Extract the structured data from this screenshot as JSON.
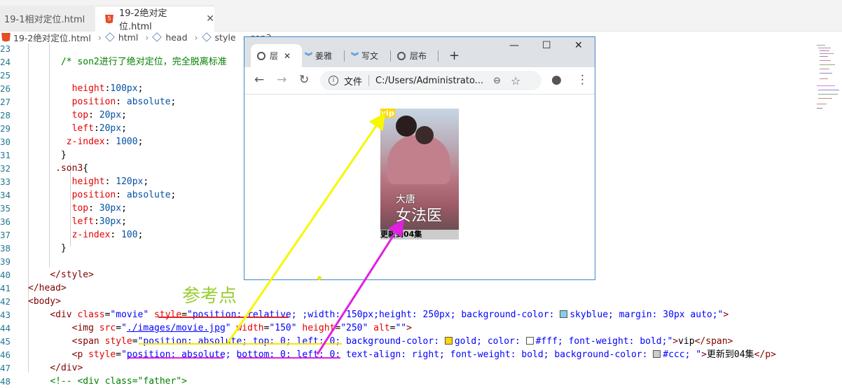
{
  "editor_tabs": [
    {
      "label": "19-1相对定位.html",
      "active": false
    },
    {
      "label": "19-2绝对定位.html",
      "active": true
    }
  ],
  "breadcrumb": [
    "19-2绝对定位.html",
    "html",
    "head",
    "style",
    "son3"
  ],
  "code_lines": [
    {
      "n": "23",
      "html": ""
    },
    {
      "n": "24",
      "html": "      <span class='c-cm'>/* son2进行了绝对定位，完全脱离标准</span>"
    },
    {
      "n": "25",
      "html": ""
    },
    {
      "n": "26",
      "html": "        <span class='c-pr'>height</span>:<span class='c-vl'>100px</span>;"
    },
    {
      "n": "27",
      "html": "        <span class='c-pr'>position</span>: <span class='c-vl'>absolute</span>;"
    },
    {
      "n": "28",
      "html": "        <span class='c-pr'>top</span>: <span class='c-vl'>20px</span>;"
    },
    {
      "n": "29",
      "html": "        <span class='c-pr'>left</span>:<span class='c-vl'>20px</span>;"
    },
    {
      "n": "30",
      "html": "       <span class='c-pr'>z-index</span>: <span class='c-vl'>1000</span>;"
    },
    {
      "n": "31",
      "html": "      }"
    },
    {
      "n": "32",
      "html": "     <span class='c-tg'>.son3</span>{"
    },
    {
      "n": "33",
      "html": "        <span class='c-pr'>height</span>: <span class='c-vl'>120px</span>;"
    },
    {
      "n": "34",
      "html": "        <span class='c-pr'>position</span>: <span class='c-vl'>absolute</span>;"
    },
    {
      "n": "35",
      "html": "        <span class='c-pr'>top</span>: <span class='c-vl'>30px</span>;"
    },
    {
      "n": "36",
      "html": "        <span class='c-pr'>left</span>:<span class='c-vl'>30px</span>;"
    },
    {
      "n": "37",
      "html": "        <span class='c-pr'>z-index</span>: <span class='c-vl'>100</span>;"
    },
    {
      "n": "38",
      "html": "      }"
    },
    {
      "n": "39",
      "html": ""
    },
    {
      "n": "40",
      "html": "    <span class='c-tg'>&lt;/style&gt;</span>"
    },
    {
      "n": "41",
      "html": "<span class='c-tg'>&lt;/head&gt;</span>"
    },
    {
      "n": "42",
      "html": "<span class='c-tg'>&lt;body&gt;</span>"
    },
    {
      "n": "43",
      "html": "    <span class='c-tg'>&lt;div</span> <span class='c-at'>class</span>=<span class='c-st'>\"movie\"</span> <span class='c-at'>style</span>=<span class='c-st'>\"position: relative; ;width: 150px;height: 250px; background-color: <i class='swatch' style='background:#87ceeb'></i>skyblue; margin: 30px auto;\"</span><span class='c-tg'>&gt;</span>"
    },
    {
      "n": "44",
      "html": "        <span class='c-tg'>&lt;img</span> <span class='c-at'>src</span>=<span class='c-st'>\"<u>./images/movie.jpg</u>\"</span> <span class='c-at'>width</span>=<span class='c-st'>\"150\"</span> <span class='c-at'>height</span>=<span class='c-st'>\"250\"</span> <span class='c-at'>alt</span>=<span class='c-st'>\"\"</span><span class='c-tg'>&gt;</span>"
    },
    {
      "n": "45",
      "html": "        <span class='c-tg'>&lt;span</span> <span class='c-at'>style</span>=<span class='c-st'>\"position: absolute; top: 0; left: 0; background-color: <i class='swatch' style='background:gold'></i>gold; color: <i class='swatch' style='background:#fff'></i>#fff; font-weight: bold;\"</span><span class='c-tg'>&gt;</span>vip<span class='c-tg'>&lt;/span&gt;</span>"
    },
    {
      "n": "46",
      "html": "        <span class='c-tg'>&lt;p</span> <span class='c-at'>style</span>=<span class='c-st'>\"position: absolute; bottom: 0; left: 0; text-align: right; font-weight: bold; background-color: <i class='swatch' style='background:#ccc'></i>#ccc; \"</span><span class='c-tg'>&gt;</span>更新到04集<span class='c-tg'>&lt;/p&gt;</span>"
    },
    {
      "n": "47",
      "html": "    <span class='c-tg'>&lt;/div&gt;</span>"
    },
    {
      "n": "48",
      "html": "    <span class='c-cm'>&lt;!-- &lt;div class=\"father\"&gt;</span>"
    }
  ],
  "annotation_label": "参考点",
  "browser": {
    "tabs": [
      {
        "label": "层",
        "icon": "globe-icon",
        "active": true
      },
      {
        "label": "姜雅",
        "icon": "chevron-icon"
      },
      {
        "label": "写文",
        "icon": "chevron-icon"
      },
      {
        "label": "层布",
        "icon": "globe-icon"
      }
    ],
    "new_tab": "+",
    "win_min": "—",
    "win_max": "☐",
    "win_close": "✕",
    "address_prefix": "文件",
    "address": "C:/Users/Administrato...",
    "movie": {
      "vip": "vip",
      "update": "更新到04集",
      "poster_title_1": "大唐",
      "poster_title_2": "女法医"
    }
  }
}
